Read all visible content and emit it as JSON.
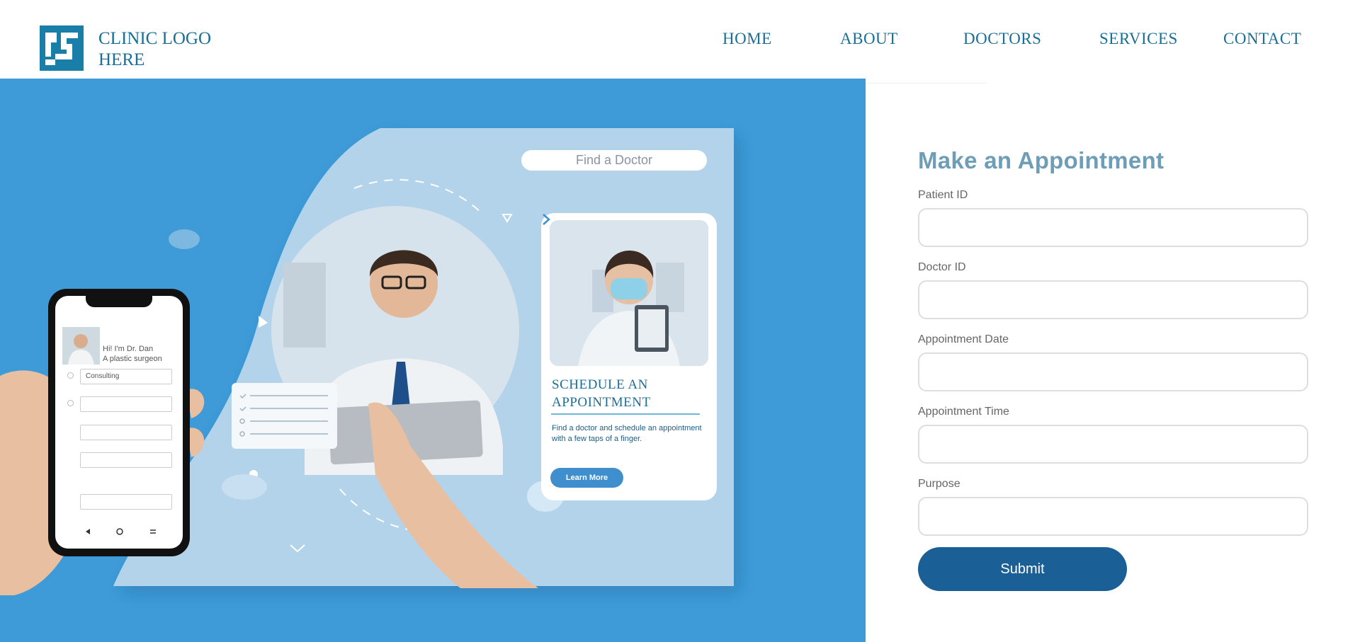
{
  "header": {
    "logo_text": "CLINIC LOGO HERE",
    "nav": [
      "HOME",
      "ABOUT",
      "DOCTORS",
      "SERVICES",
      "CONTACT"
    ]
  },
  "hero": {
    "search_placeholder": "Find a Doctor",
    "card": {
      "title": "SCHEDULE AN APPOINTMENT",
      "description": "Find a doctor and schedule an appointment with a few taps of a finger.",
      "button": "Learn More"
    },
    "phone": {
      "greeting_line1": "Hi! I'm  Dr. Dan",
      "greeting_line2": "A plastic surgeon",
      "field1": "Consulting"
    }
  },
  "form": {
    "title": "Make an Appointment",
    "fields": [
      {
        "label": "Patient ID"
      },
      {
        "label": "Doctor ID"
      },
      {
        "label": "Appointment Date"
      },
      {
        "label": "Appointment Time"
      },
      {
        "label": "Purpose"
      }
    ],
    "submit_label": "Submit"
  },
  "colors": {
    "brand": "#1a6f96",
    "hero_bg": "#3f9bd8",
    "submit_bg": "#1a5f96",
    "form_title": "#6e9db8"
  }
}
